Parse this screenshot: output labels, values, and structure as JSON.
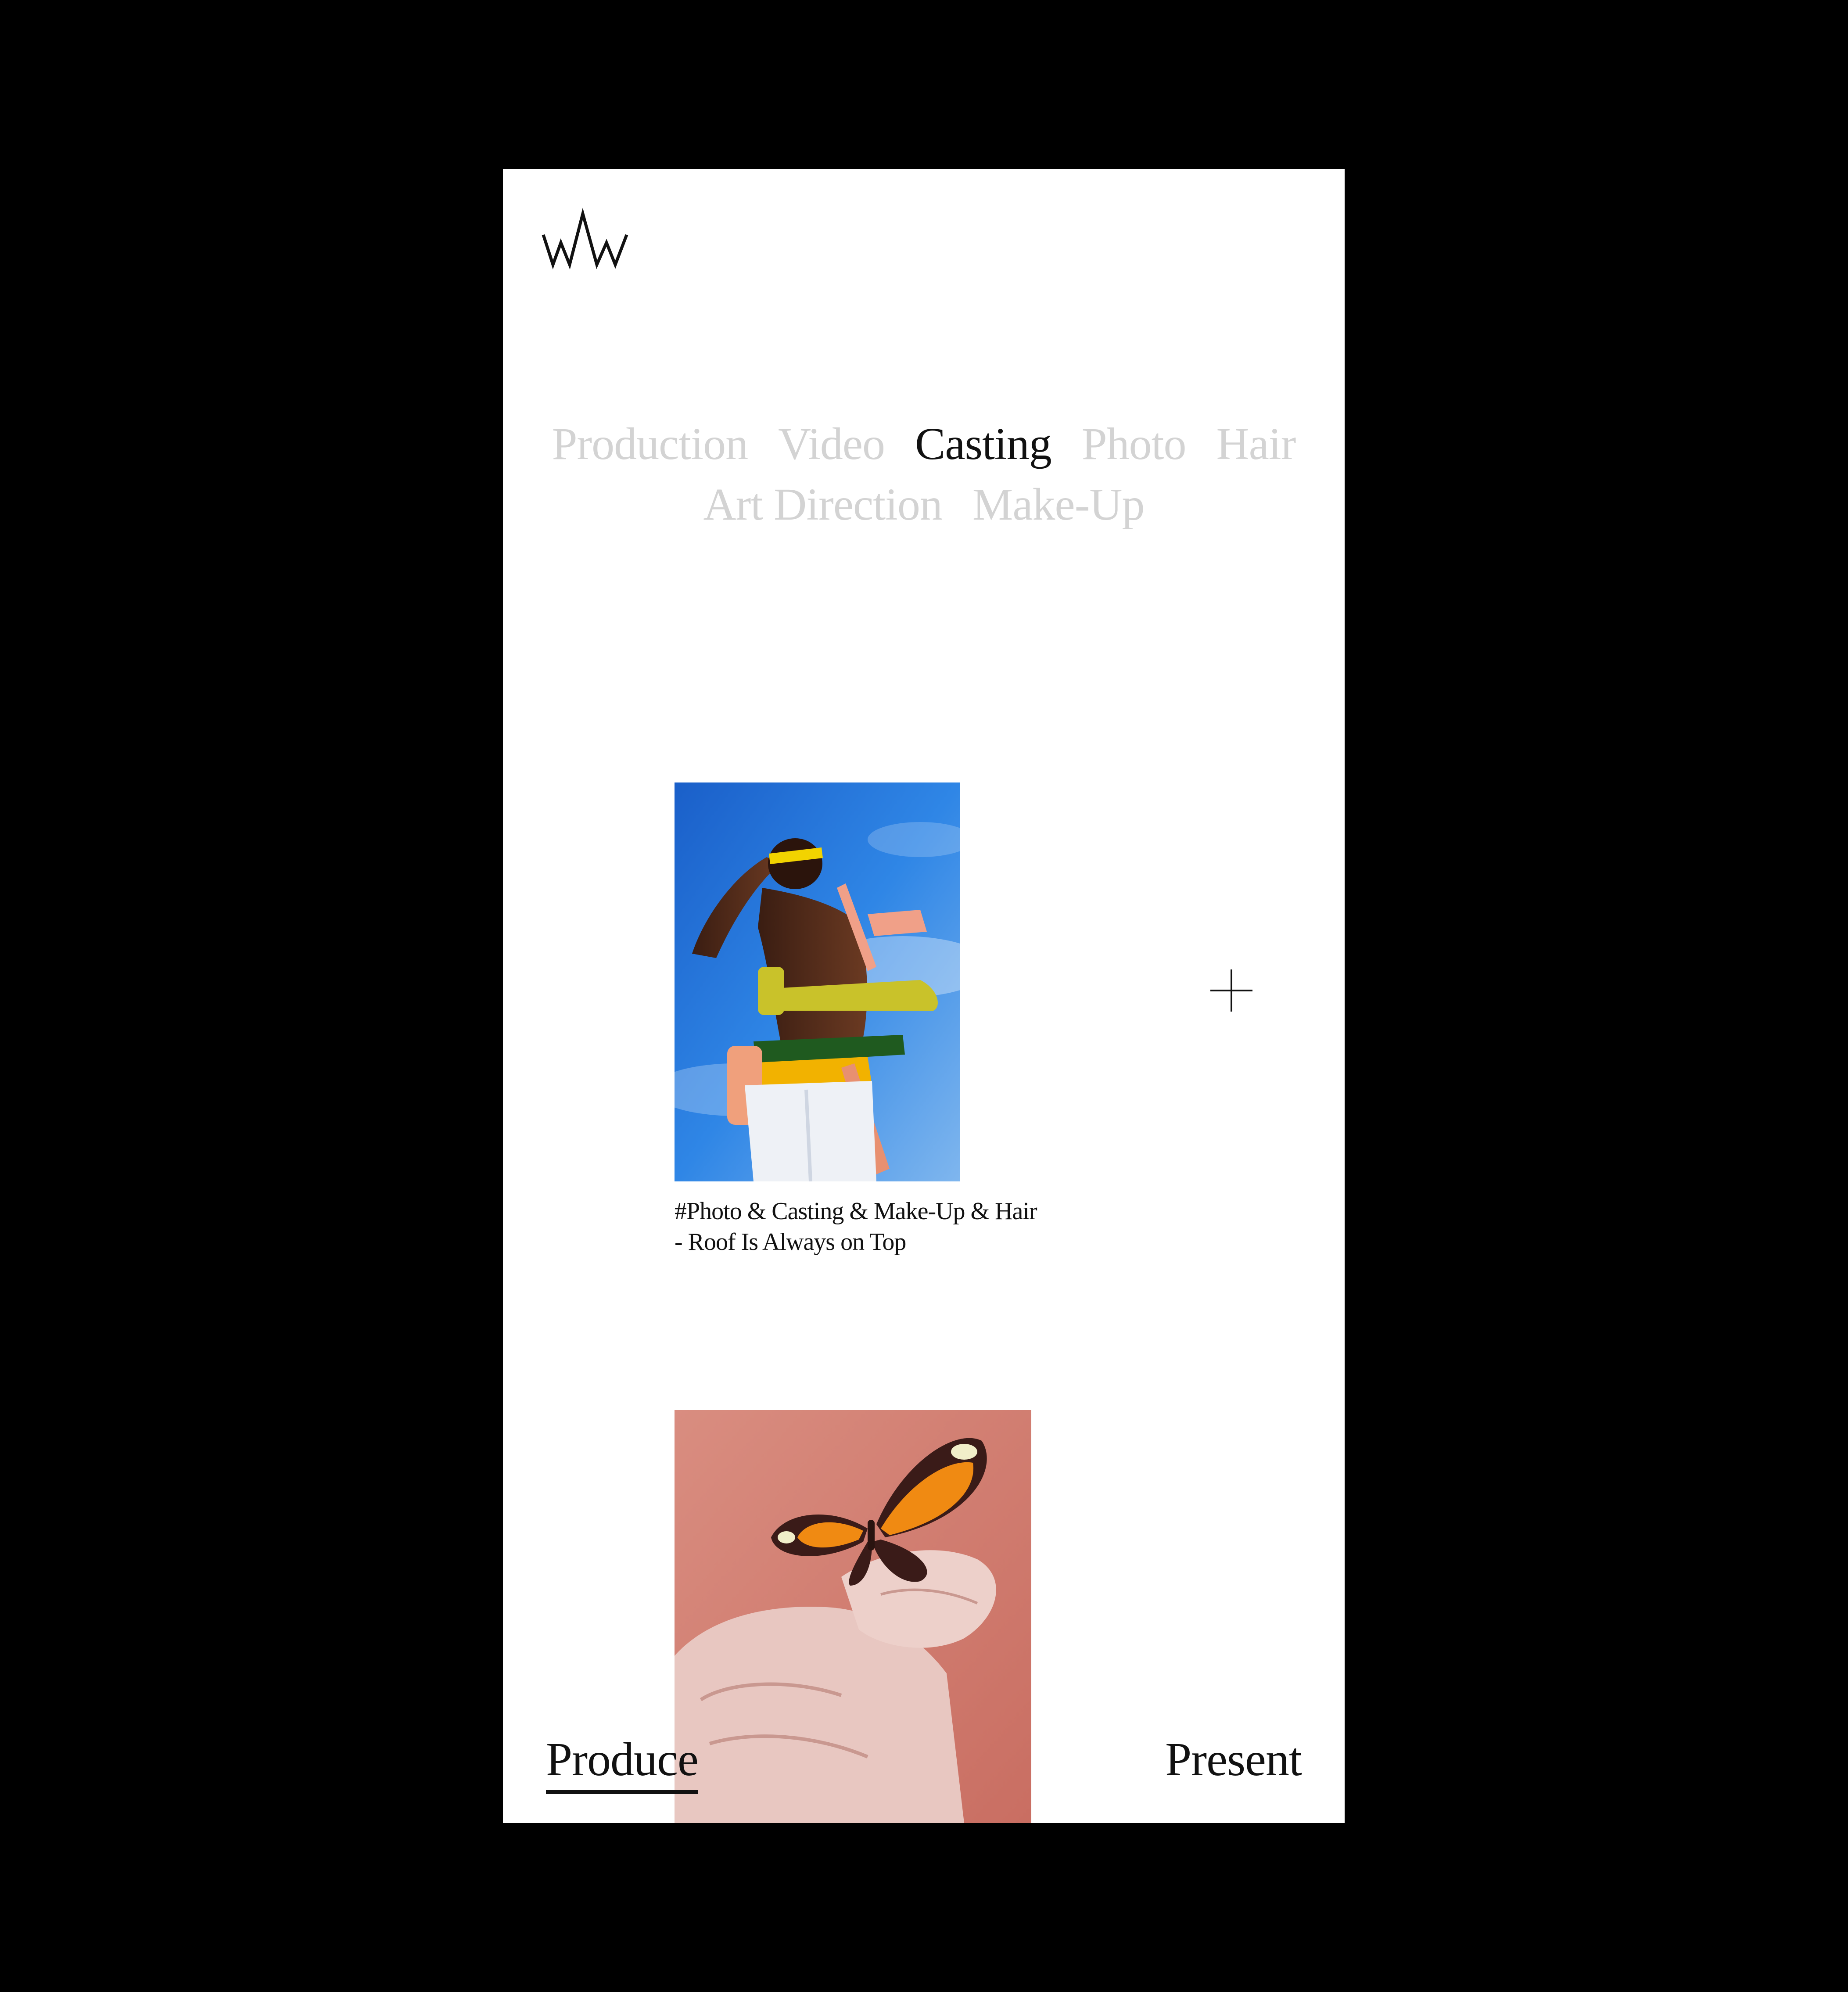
{
  "header": {
    "logo_text": "wVw"
  },
  "filters": {
    "row1": [
      {
        "label": "Production",
        "active": false
      },
      {
        "label": "Video",
        "active": false
      },
      {
        "label": "Casting",
        "active": true
      },
      {
        "label": "Photo",
        "active": false
      },
      {
        "label": "Hair",
        "active": false
      }
    ],
    "row2": [
      {
        "label": "Art Direction",
        "active": false
      },
      {
        "label": "Make-Up",
        "active": false
      }
    ]
  },
  "projects": [
    {
      "image": "model-sky-photo",
      "caption_line1": "#Photo & Casting & Make-Up & Hair",
      "caption_line2": "- Roof Is Always on Top"
    },
    {
      "image": "butterfly-hands-photo"
    }
  ],
  "icons": {
    "expand": "plus-icon"
  },
  "bottom_nav": {
    "produce": "Produce",
    "present": "Present",
    "active": "produce"
  },
  "colors": {
    "background": "#000000",
    "screen": "#ffffff",
    "text": "#111111",
    "inactive": "#d3d3d3",
    "sky": "#1f74d8",
    "accent_yellow": "#f2c400",
    "accent_orange": "#e98a1c"
  }
}
